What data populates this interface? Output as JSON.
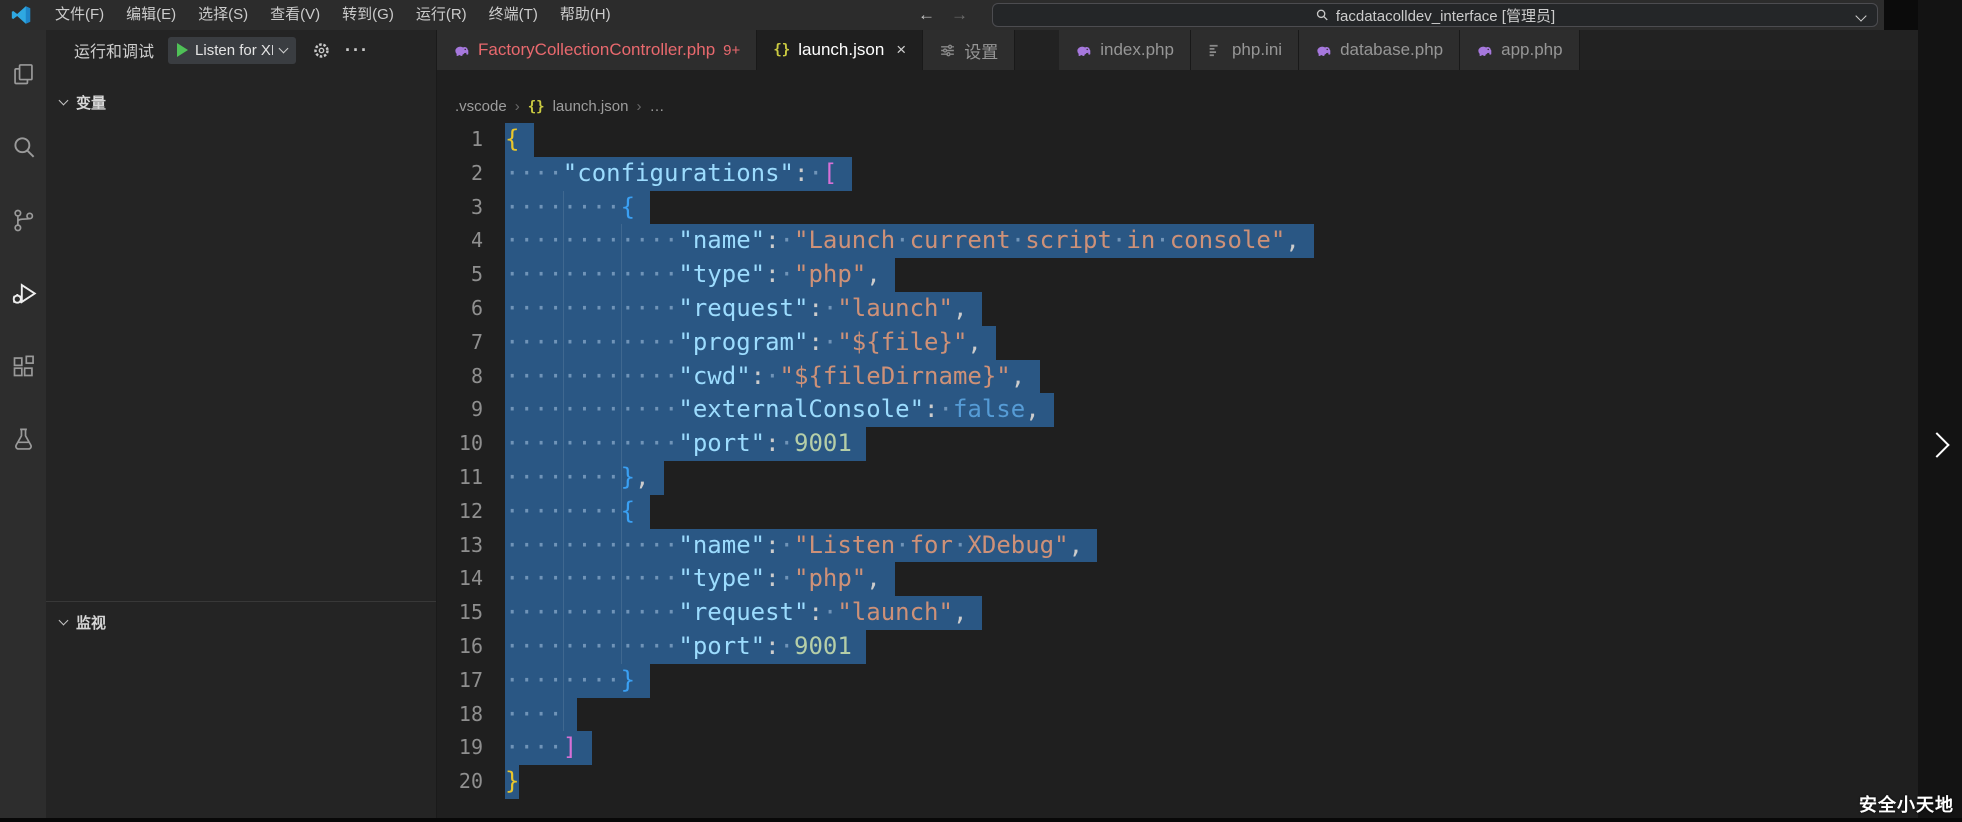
{
  "title_bar": {
    "menu_items": [
      "文件(F)",
      "编辑(E)",
      "选择(S)",
      "查看(V)",
      "转到(G)",
      "运行(R)",
      "终端(T)",
      "帮助(H)"
    ],
    "back_arrow": "←",
    "forward_arrow": "→",
    "search_value": "facdatacolldev_interface [管理员]"
  },
  "activity_bar": {
    "items": [
      {
        "icon": "explorer"
      },
      {
        "icon": "search"
      },
      {
        "icon": "source-control"
      },
      {
        "icon": "run-debug",
        "active": true
      },
      {
        "icon": "extensions"
      },
      {
        "icon": "testing"
      }
    ]
  },
  "sidebar": {
    "title": "运行和调试",
    "debug_dropdown_value": "Listen for XDebug",
    "more_icon": "···",
    "sections": [
      {
        "label": "变量"
      },
      {
        "label": "监视"
      }
    ]
  },
  "tabs": [
    {
      "label": "FactoryCollectionController.php",
      "icon": "php",
      "badge": "9+",
      "state": "error"
    },
    {
      "label": "launch.json",
      "icon": "json",
      "active": true,
      "close": "×"
    },
    {
      "label": "设置",
      "icon": "settings"
    },
    {
      "label": "index.php",
      "icon": "php",
      "gap_before": true
    },
    {
      "label": "php.ini",
      "icon": "ini"
    },
    {
      "label": "database.php",
      "icon": "php"
    },
    {
      "label": "app.php",
      "icon": "php"
    }
  ],
  "breadcrumb": {
    "segments": [
      ".vscode",
      "launch.json",
      "…"
    ],
    "separator": "›"
  },
  "editor": {
    "lines": [
      {
        "segs": [
          [
            "b1",
            "{"
          ]
        ]
      },
      {
        "segs": [
          [
            "wsd",
            "    "
          ],
          [
            "key",
            "\"configurations\""
          ],
          [
            "pun",
            ": "
          ],
          [
            "b2",
            "["
          ]
        ]
      },
      {
        "segs": [
          [
            "wsd",
            "        "
          ],
          [
            "b3",
            "{"
          ]
        ]
      },
      {
        "segs": [
          [
            "wsd",
            "            "
          ],
          [
            "key",
            "\"name\""
          ],
          [
            "pun",
            ": "
          ],
          [
            "str",
            "\"Launch current script in console\""
          ],
          [
            "pun",
            ","
          ]
        ]
      },
      {
        "segs": [
          [
            "wsd",
            "            "
          ],
          [
            "key",
            "\"type\""
          ],
          [
            "pun",
            ": "
          ],
          [
            "str",
            "\"php\""
          ],
          [
            "pun",
            ","
          ]
        ]
      },
      {
        "segs": [
          [
            "wsd",
            "            "
          ],
          [
            "key",
            "\"request\""
          ],
          [
            "pun",
            ": "
          ],
          [
            "str",
            "\"launch\""
          ],
          [
            "pun",
            ","
          ]
        ]
      },
      {
        "segs": [
          [
            "wsd",
            "            "
          ],
          [
            "key",
            "\"program\""
          ],
          [
            "pun",
            ": "
          ],
          [
            "str",
            "\"${file}\""
          ],
          [
            "pun",
            ","
          ]
        ]
      },
      {
        "segs": [
          [
            "wsd",
            "            "
          ],
          [
            "key",
            "\"cwd\""
          ],
          [
            "pun",
            ": "
          ],
          [
            "str",
            "\"${fileDirname}\""
          ],
          [
            "pun",
            ","
          ]
        ]
      },
      {
        "segs": [
          [
            "wsd",
            "            "
          ],
          [
            "key",
            "\"externalConsole\""
          ],
          [
            "pun",
            ": "
          ],
          [
            "kw",
            "false"
          ],
          [
            "pun",
            ","
          ]
        ]
      },
      {
        "segs": [
          [
            "wsd",
            "            "
          ],
          [
            "key",
            "\"port\""
          ],
          [
            "pun",
            ": "
          ],
          [
            "numv",
            "9001"
          ]
        ]
      },
      {
        "segs": [
          [
            "wsd",
            "        "
          ],
          [
            "b3",
            "}"
          ],
          [
            "pun",
            ","
          ]
        ]
      },
      {
        "segs": [
          [
            "wsd",
            "        "
          ],
          [
            "b3",
            "{"
          ]
        ]
      },
      {
        "segs": [
          [
            "wsd",
            "            "
          ],
          [
            "key",
            "\"name\""
          ],
          [
            "pun",
            ": "
          ],
          [
            "str",
            "\"Listen for XDebug\""
          ],
          [
            "pun",
            ","
          ]
        ]
      },
      {
        "segs": [
          [
            "wsd",
            "            "
          ],
          [
            "key",
            "\"type\""
          ],
          [
            "pun",
            ": "
          ],
          [
            "str",
            "\"php\""
          ],
          [
            "pun",
            ","
          ]
        ]
      },
      {
        "segs": [
          [
            "wsd",
            "            "
          ],
          [
            "key",
            "\"request\""
          ],
          [
            "pun",
            ": "
          ],
          [
            "str",
            "\"launch\""
          ],
          [
            "pun",
            ","
          ]
        ]
      },
      {
        "segs": [
          [
            "wsd",
            "            "
          ],
          [
            "key",
            "\"port\""
          ],
          [
            "pun",
            ": "
          ],
          [
            "numv",
            "9001"
          ]
        ]
      },
      {
        "segs": [
          [
            "wsd",
            "        "
          ],
          [
            "b3",
            "}"
          ]
        ]
      },
      {
        "segs": [
          [
            "wsd",
            "    "
          ]
        ]
      },
      {
        "segs": [
          [
            "wsd",
            "    "
          ],
          [
            "b2",
            "]"
          ]
        ]
      },
      {
        "segs": [
          [
            "b1",
            "}"
          ]
        ]
      }
    ]
  },
  "overlay": {
    "watermark": "安全小天地"
  },
  "colors": {
    "selection": "#2a5784",
    "error_tab_text": "#e9696e",
    "json_key": "#9cdcfe",
    "json_string": "#ce9178",
    "json_number": "#b5cea8",
    "json_keyword": "#569cd6",
    "bracket_level1": "#e9c62c",
    "bracket_level2": "#d670d6",
    "bracket_level3": "#3aa0f3",
    "debug_play_green": "#4fc157",
    "php_icon_purple": "#a678dd"
  }
}
